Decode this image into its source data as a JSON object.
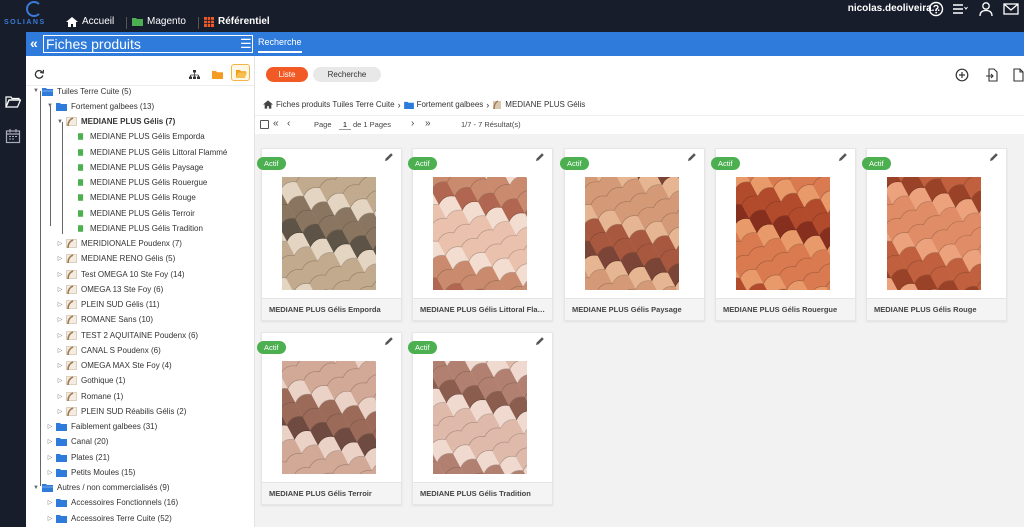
{
  "brand": {
    "name": "SOLIANS"
  },
  "nav": {
    "items": [
      {
        "label": "Accueil"
      },
      {
        "label": "Magento"
      },
      {
        "label": "Référentiel"
      }
    ],
    "user": "nicolas.deoliveira...",
    "colors": {
      "bar": "#171d2b",
      "home": "#ffffff",
      "magento": "#4caf50",
      "referentiel": "#f15a24"
    }
  },
  "titlebar": {
    "value": "Fiches produits",
    "tab": "Recherche",
    "color": "#2f7bdc"
  },
  "tree": {
    "rows": [
      {
        "label": "Tuiles Terre Cuite (5)",
        "level": 0,
        "arrow": "down",
        "icon": "folder-open-blue"
      },
      {
        "label": "Fortement galbees (13)",
        "level": 1,
        "arrow": "down",
        "icon": "folder-blue"
      },
      {
        "label": "MEDIANE PLUS Gélis (7)",
        "level": 2,
        "arrow": "down",
        "icon": "tile-product",
        "bold": true
      },
      {
        "label": "MEDIANE PLUS Gélis Emporda",
        "level": 3,
        "arrow": "",
        "icon": "doc-green"
      },
      {
        "label": "MEDIANE PLUS Gélis Littoral Flammé",
        "level": 3,
        "arrow": "",
        "icon": "doc-green"
      },
      {
        "label": "MEDIANE PLUS Gélis Paysage",
        "level": 3,
        "arrow": "",
        "icon": "doc-green"
      },
      {
        "label": "MEDIANE PLUS Gélis Rouergue",
        "level": 3,
        "arrow": "",
        "icon": "doc-green"
      },
      {
        "label": "MEDIANE PLUS Gélis Rouge",
        "level": 3,
        "arrow": "",
        "icon": "doc-green"
      },
      {
        "label": "MEDIANE PLUS Gélis Terroir",
        "level": 3,
        "arrow": "",
        "icon": "doc-green"
      },
      {
        "label": "MEDIANE PLUS Gélis Tradition",
        "level": 3,
        "arrow": "",
        "icon": "doc-green"
      },
      {
        "label": "MERIDIONALE Poudenx (7)",
        "level": 2,
        "arrow": "right",
        "icon": "tile-product"
      },
      {
        "label": "MEDIANE RENO Gélis (5)",
        "level": 2,
        "arrow": "right",
        "icon": "tile-product"
      },
      {
        "label": "Test OMEGA 10 Ste Foy (14)",
        "level": 2,
        "arrow": "right",
        "icon": "tile-product"
      },
      {
        "label": "OMEGA 13 Ste Foy (6)",
        "level": 2,
        "arrow": "right",
        "icon": "tile-product"
      },
      {
        "label": "PLEIN SUD Gélis (11)",
        "level": 2,
        "arrow": "right",
        "icon": "tile-product"
      },
      {
        "label": "ROMANE Sans (10)",
        "level": 2,
        "arrow": "right",
        "icon": "tile-product"
      },
      {
        "label": "TEST 2 AQUITAINE Poudenx (6)",
        "level": 2,
        "arrow": "right",
        "icon": "tile-product"
      },
      {
        "label": "CANAL S Poudenx (6)",
        "level": 2,
        "arrow": "right",
        "icon": "tile-product"
      },
      {
        "label": "OMEGA MAX Ste Foy (4)",
        "level": 2,
        "arrow": "right",
        "icon": "tile-product"
      },
      {
        "label": "Gothique (1)",
        "level": 2,
        "arrow": "right",
        "icon": "tile-product"
      },
      {
        "label": "Romane (1)",
        "level": 2,
        "arrow": "right",
        "icon": "tile-product"
      },
      {
        "label": "PLEIN SUD Réabilis Gélis (2)",
        "level": 2,
        "arrow": "right",
        "icon": "tile-product"
      },
      {
        "label": "Faiblement galbees (31)",
        "level": 1,
        "arrow": "right",
        "icon": "folder-blue"
      },
      {
        "label": "Canal (20)",
        "level": 1,
        "arrow": "right",
        "icon": "folder-blue"
      },
      {
        "label": "Plates (21)",
        "level": 1,
        "arrow": "right",
        "icon": "folder-blue"
      },
      {
        "label": "Petits Moules (15)",
        "level": 1,
        "arrow": "right",
        "icon": "folder-blue"
      },
      {
        "label": "Autres / non commercialisés (9)",
        "level": 0,
        "arrow": "down",
        "icon": "folder-open-blue"
      },
      {
        "label": "Accessoires Fonctionnels (16)",
        "level": 1,
        "arrow": "right",
        "icon": "folder-blue"
      },
      {
        "label": "Accessoires Terre Cuite (52)",
        "level": 1,
        "arrow": "right",
        "icon": "folder-blue"
      }
    ]
  },
  "toolbar": {
    "liste_label": "Liste",
    "recherche_label": "Recherche",
    "accent": "#f15a24"
  },
  "breadcrumb": {
    "items": [
      {
        "label": "Fiches produits Tuiles Terre Cuite",
        "icon": "home-icon"
      },
      {
        "label": "Fortement galbees",
        "icon": "folder-icon"
      },
      {
        "label": "MEDIANE PLUS Gélis",
        "icon": "tile-product-icon"
      }
    ]
  },
  "pager": {
    "page_label": "Page",
    "page_value": "1",
    "of_pages": "de 1 Pages",
    "results": "1/7 - 7 Résultat(s)"
  },
  "cards": {
    "badge": "Actif",
    "badge_color": "#4caf50",
    "items": [
      {
        "name": "MEDIANE PLUS Gélis Emporda",
        "palette": [
          "#8a7560",
          "#c2aa8e",
          "#5d5346",
          "#e4d5c2"
        ]
      },
      {
        "name": "MEDIANE PLUS Gélis Littoral Flammé",
        "palette": [
          "#c98a6d",
          "#e9c1ad",
          "#b06650",
          "#f3ddd0"
        ]
      },
      {
        "name": "MEDIANE PLUS Gélis Paysage",
        "palette": [
          "#a8583e",
          "#d49a78",
          "#7a4436",
          "#e6b692"
        ]
      },
      {
        "name": "MEDIANE PLUS Gélis Rouergue",
        "palette": [
          "#b24a2c",
          "#d97a50",
          "#862f1f",
          "#e89a6a"
        ]
      },
      {
        "name": "MEDIANE PLUS Gélis Rouge",
        "palette": [
          "#c0603e",
          "#e08d67",
          "#9a4228",
          "#eba27d"
        ]
      },
      {
        "name": "MEDIANE PLUS Gélis Terroir",
        "palette": [
          "#9b6a58",
          "#d2a897",
          "#6e4a40",
          "#ead2c6"
        ]
      },
      {
        "name": "MEDIANE PLUS Gélis Tradition",
        "palette": [
          "#b28070",
          "#dfb9aa",
          "#8a5d4f",
          "#f0dad0"
        ]
      }
    ]
  }
}
